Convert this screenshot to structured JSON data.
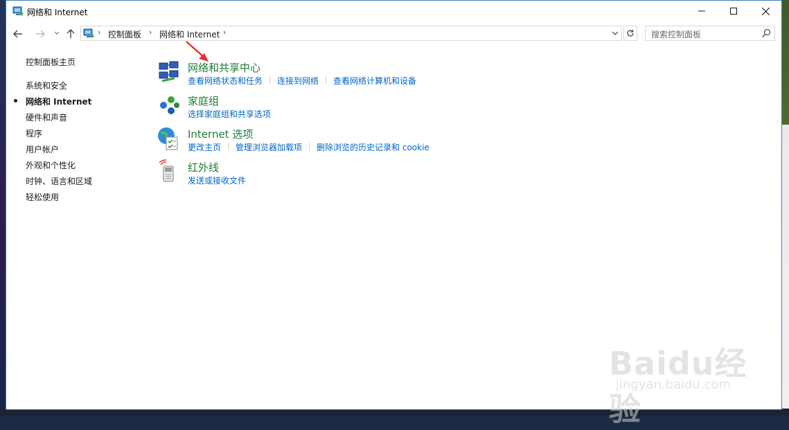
{
  "window": {
    "title": "网络和 Internet"
  },
  "address_bar": {
    "crumbs": [
      "控制面板",
      "网络和 Internet"
    ],
    "search_placeholder": "搜索控制面板"
  },
  "sidebar": {
    "home": "控制面板主页",
    "items": [
      {
        "label": "系统和安全",
        "active": false
      },
      {
        "label": "网络和 Internet",
        "active": true
      },
      {
        "label": "硬件和声音",
        "active": false
      },
      {
        "label": "程序",
        "active": false
      },
      {
        "label": "用户帐户",
        "active": false
      },
      {
        "label": "外观和个性化",
        "active": false
      },
      {
        "label": "时钟、语言和区域",
        "active": false
      },
      {
        "label": "轻松使用",
        "active": false
      }
    ]
  },
  "categories": [
    {
      "title": "网络和共享中心",
      "icon": "network-sharing-icon",
      "links": [
        "查看网络状态和任务",
        "连接到网络",
        "查看网络计算机和设备"
      ]
    },
    {
      "title": "家庭组",
      "icon": "homegroup-icon",
      "links": [
        "选择家庭组和共享选项"
      ]
    },
    {
      "title": "Internet 选项",
      "icon": "internet-options-icon",
      "links": [
        "更改主页",
        "管理浏览器加载项",
        "删除浏览的历史记录和 cookie"
      ]
    },
    {
      "title": "红外线",
      "icon": "infrared-icon",
      "links": [
        "发送或接收文件"
      ]
    }
  ],
  "watermark": {
    "logo": "Baidu经验",
    "url": "jingyan.baidu.com"
  },
  "colors": {
    "category_title": "#1e7b34",
    "link": "#0066cc",
    "annotation_arrow": "#e8302a"
  }
}
